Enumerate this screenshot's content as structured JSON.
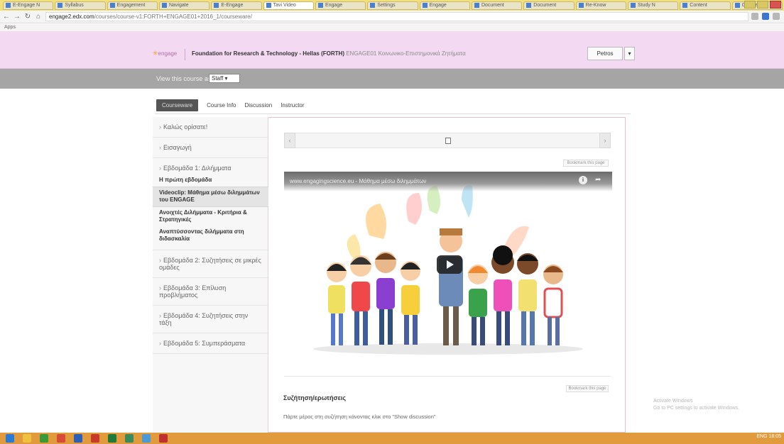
{
  "browser": {
    "tabs": [
      {
        "label": "E-Engage N"
      },
      {
        "label": "Syllabus"
      },
      {
        "label": "Engagement"
      },
      {
        "label": "Navigate"
      },
      {
        "label": "E-Engage"
      },
      {
        "label": "Tavi Video",
        "active": true
      },
      {
        "label": "Engage"
      },
      {
        "label": "Settings"
      },
      {
        "label": "Engage"
      },
      {
        "label": "Document"
      },
      {
        "label": "Document"
      },
      {
        "label": "Re-Know"
      },
      {
        "label": "Study N"
      },
      {
        "label": "Content"
      },
      {
        "label": "Google"
      }
    ],
    "url_host": "engage2.edx.com",
    "url_path": "/courses/course-v1:FORTH+ENGAGE01+2016_1/courseware/",
    "bookmarks_label": "Apps"
  },
  "header": {
    "logo_text": "engage",
    "org_name": "Foundation for Research & Technology - Hellas (FORTH)",
    "course_code": "ENGAGE01 Κοινωνικο-Επιστημονικά Ζητήματα",
    "user_button": "Petros",
    "user_caret": "▾"
  },
  "viewbar": {
    "label": "View this course as:",
    "selected": "Staff"
  },
  "course_tabs": [
    {
      "label": "Courseware",
      "active": true
    },
    {
      "label": "Course Info"
    },
    {
      "label": "Discussion"
    },
    {
      "label": "Instructor"
    }
  ],
  "sidebar": {
    "sections": [
      {
        "label": "Καλώς ορίσατε!",
        "open": false
      },
      {
        "label": "Εισαγωγή",
        "open": false
      },
      {
        "label": "Εβδομάδα 1: Διλήμματα",
        "open": true,
        "subsections": [
          {
            "label": "Η πρώτη εβδομάδα",
            "current": false
          },
          {
            "label": "Videoclip: Μάθημα μέσω διλημμάτων του ENGAGE"
          },
          {
            "label": "Ανοιχτές Διλήμματα - Κριτήρια & Στρατηγικές"
          },
          {
            "label": "Αναπτύσσοντας διλήμματα στη διδασκαλία"
          }
        ]
      },
      {
        "label": "Εβδομάδα 2: Συζητήσεις σε μικρές ομάδες",
        "open": false
      },
      {
        "label": "Εβδομάδα 3: Επίλυση προβλήματος",
        "open": false
      },
      {
        "label": "Εβδομάδα 4: Συζητήσεις στην τάξη",
        "open": false
      },
      {
        "label": "Εβδομάδα 5: Συμπεράσματα",
        "open": false
      }
    ],
    "current_subsection": "Videoclip: Μάθημα μέσω διλημμάτων του ENGAGE"
  },
  "sequence": {
    "prev_icon": "‹",
    "next_icon": "›"
  },
  "content": {
    "bookmark_label": "Bookmark this page",
    "video_title": "www.engagingscience.eu - Μάθημα μέσω διλημμάτων",
    "video_info_icon": "i",
    "video_share_icon": "➦",
    "bookmark_label_2": "Bookmark this page",
    "section_heading": "Συζήτηση/ερωτήσεις",
    "section_text": "Πάρτε μέρος στη συζήτηση κάνοντας κλικ στο \"Show discussion\""
  },
  "watermark": {
    "line1": "Activate Windows",
    "line2": "Go to PC settings to activate Windows."
  },
  "taskbar": {
    "tray_text": "ENG  18:05"
  },
  "colors": {
    "header_bg": "#f3d9f2",
    "viewbar_bg": "#a5a5a5",
    "taskbar": "#e19a3c",
    "frame_border": "#e7bfc6"
  }
}
